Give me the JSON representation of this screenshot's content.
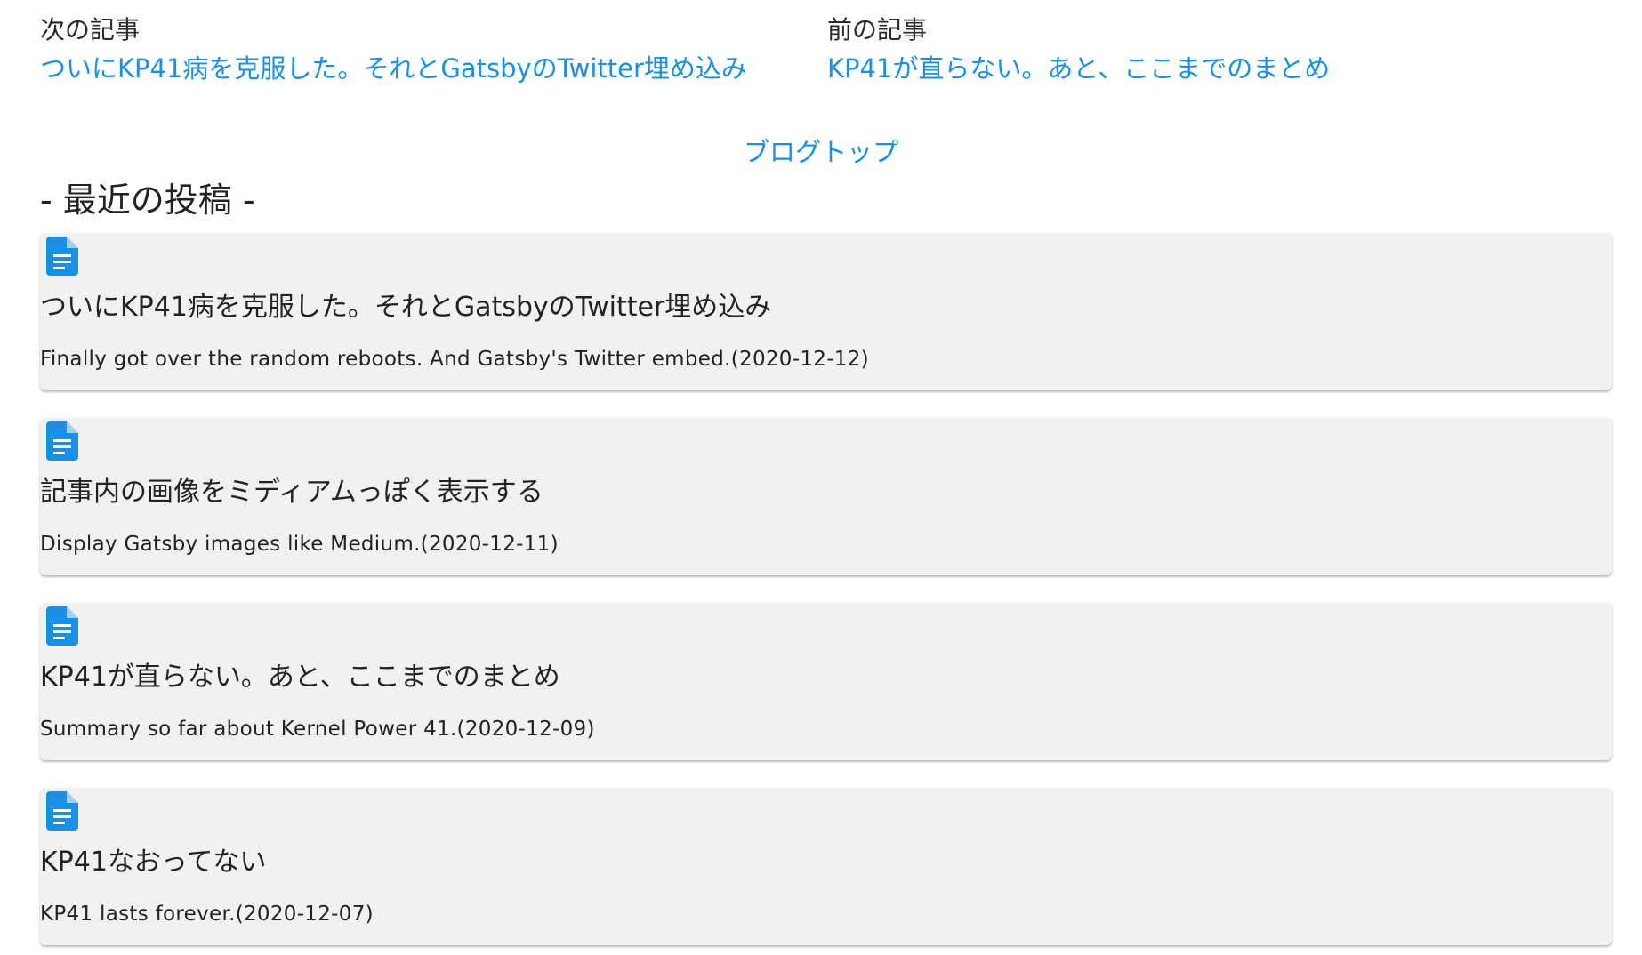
{
  "nav": {
    "next": {
      "label": "次の記事",
      "link": "ついにKP41病を克服した。それとGatsbyのTwitter埋め込み"
    },
    "prev": {
      "label": "前の記事",
      "link": "KP41が直らない。あと、ここまでのまとめ"
    }
  },
  "blog_top": "ブログトップ",
  "recent": {
    "title": "- 最近の投稿 -",
    "icon": "document-icon",
    "accent_color": "#1a8fe8",
    "posts": [
      {
        "title": "ついにKP41病を克服した。それとGatsbyのTwitter埋め込み",
        "desc": "Finally got over the random reboots. And Gatsby's Twitter embed.(2020-12-12)"
      },
      {
        "title": "記事内の画像をミディアムっぽく表示する",
        "desc": "Display Gatsby images like Medium.(2020-12-11)"
      },
      {
        "title": "KP41が直らない。あと、ここまでのまとめ",
        "desc": "Summary so far about Kernel Power 41.(2020-12-09)"
      },
      {
        "title": "KP41なおってない",
        "desc": "KP41 lasts forever.(2020-12-07)"
      }
    ]
  }
}
